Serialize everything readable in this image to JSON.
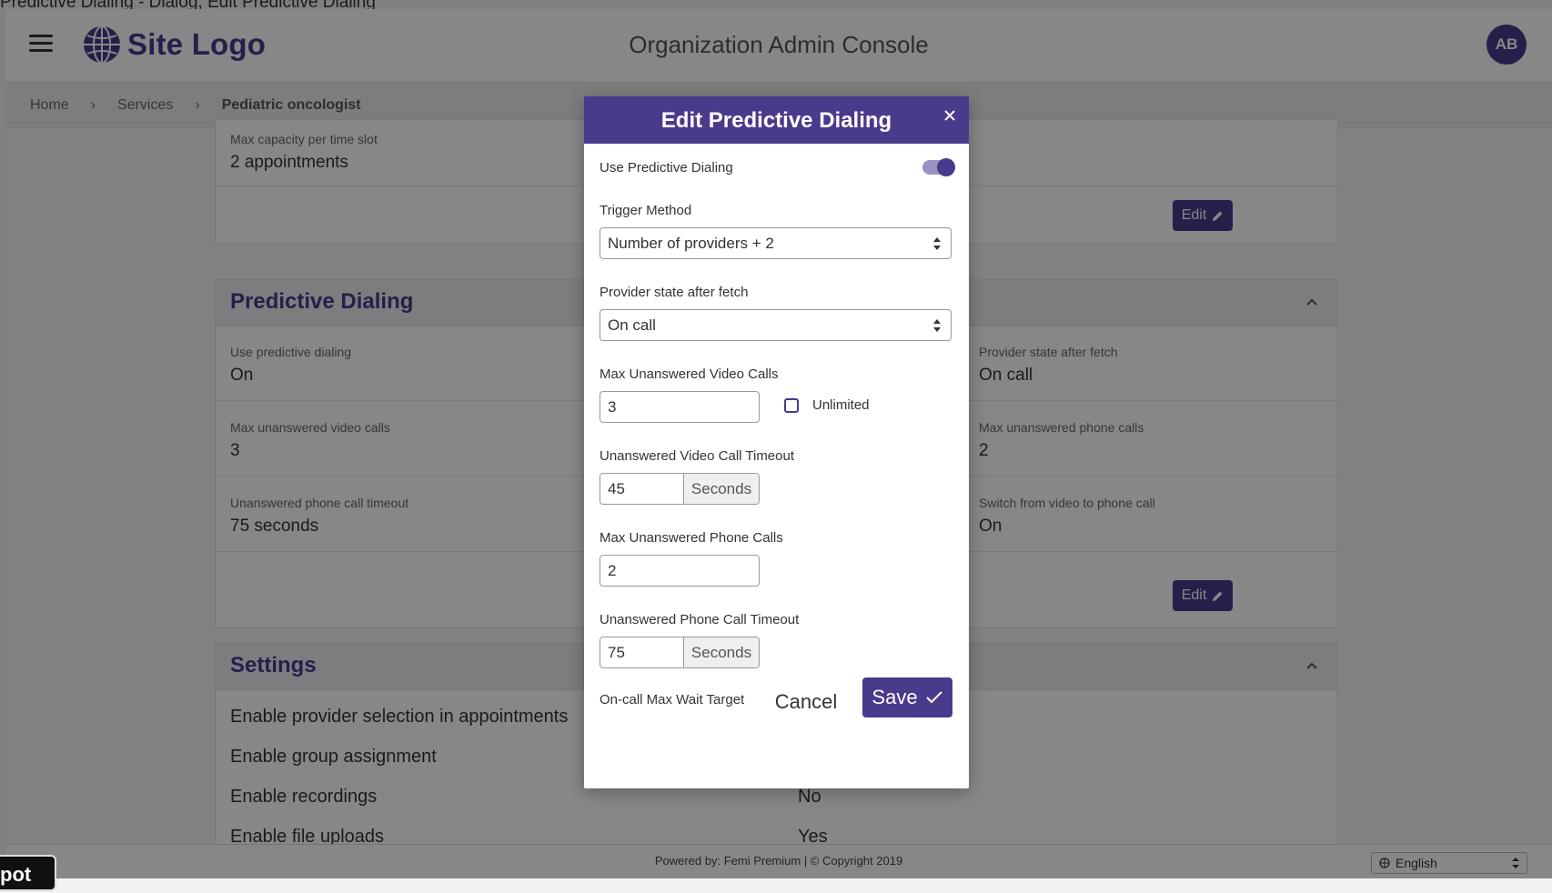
{
  "page_title": "Predictive Dialing - Dialog, Edit Predictive Dialing",
  "header": {
    "logo_text": "Site Logo",
    "console_title": "Organization Admin Console",
    "avatar_initials": "AB"
  },
  "breadcrumb": {
    "items": [
      "Home",
      "Services",
      "Pediatric oncologist"
    ]
  },
  "capacity": {
    "label": "Max capacity per time slot",
    "value": "2 appointments",
    "edit_label": "Edit"
  },
  "predictive": {
    "title": "Predictive Dialing",
    "fields": [
      {
        "label": "Use predictive dialing",
        "value": "On"
      },
      {
        "label": "Provider state after fetch",
        "value": "On call"
      },
      {
        "label": "Max unanswered video calls",
        "value": "3"
      },
      {
        "label": "Max unanswered phone calls",
        "value": "2"
      },
      {
        "label": "Unanswered phone call timeout",
        "value": "75 seconds"
      },
      {
        "label": "Switch from video to phone call",
        "value": "On"
      }
    ],
    "edit_label": "Edit"
  },
  "settings": {
    "title": "Settings",
    "rows": [
      {
        "label": "Enable provider selection in appointments",
        "value": ""
      },
      {
        "label": "Enable group assignment",
        "value": ""
      },
      {
        "label": "Enable recordings",
        "value": "No"
      },
      {
        "label": "Enable file uploads",
        "value": "Yes"
      }
    ]
  },
  "footer": {
    "text": "Powered by: Femi Premium | © Copyright 2019",
    "language": "English"
  },
  "toast": "pot",
  "modal": {
    "title": "Edit Predictive Dialing",
    "use_predictive_label": "Use Predictive Dialing",
    "use_predictive_on": true,
    "trigger_label": "Trigger Method",
    "trigger_value": "Number of providers + 2",
    "provider_state_label": "Provider state after fetch",
    "provider_state_value": "On call",
    "max_video_label": "Max Unanswered Video Calls",
    "max_video_value": "3",
    "unlimited_label": "Unlimited",
    "video_timeout_label": "Unanswered Video Call Timeout",
    "video_timeout_value": "45",
    "seconds_label": "Seconds",
    "max_phone_label": "Max Unanswered Phone Calls",
    "max_phone_value": "2",
    "phone_timeout_label": "Unanswered Phone Call Timeout",
    "phone_timeout_value": "75",
    "oncall_wait_label": "On-call Max Wait Target",
    "cancel_label": "Cancel",
    "save_label": "Save"
  },
  "colors": {
    "brand": "#4a3a8c",
    "overlay": "rgba(0,0,0,0.47)"
  }
}
